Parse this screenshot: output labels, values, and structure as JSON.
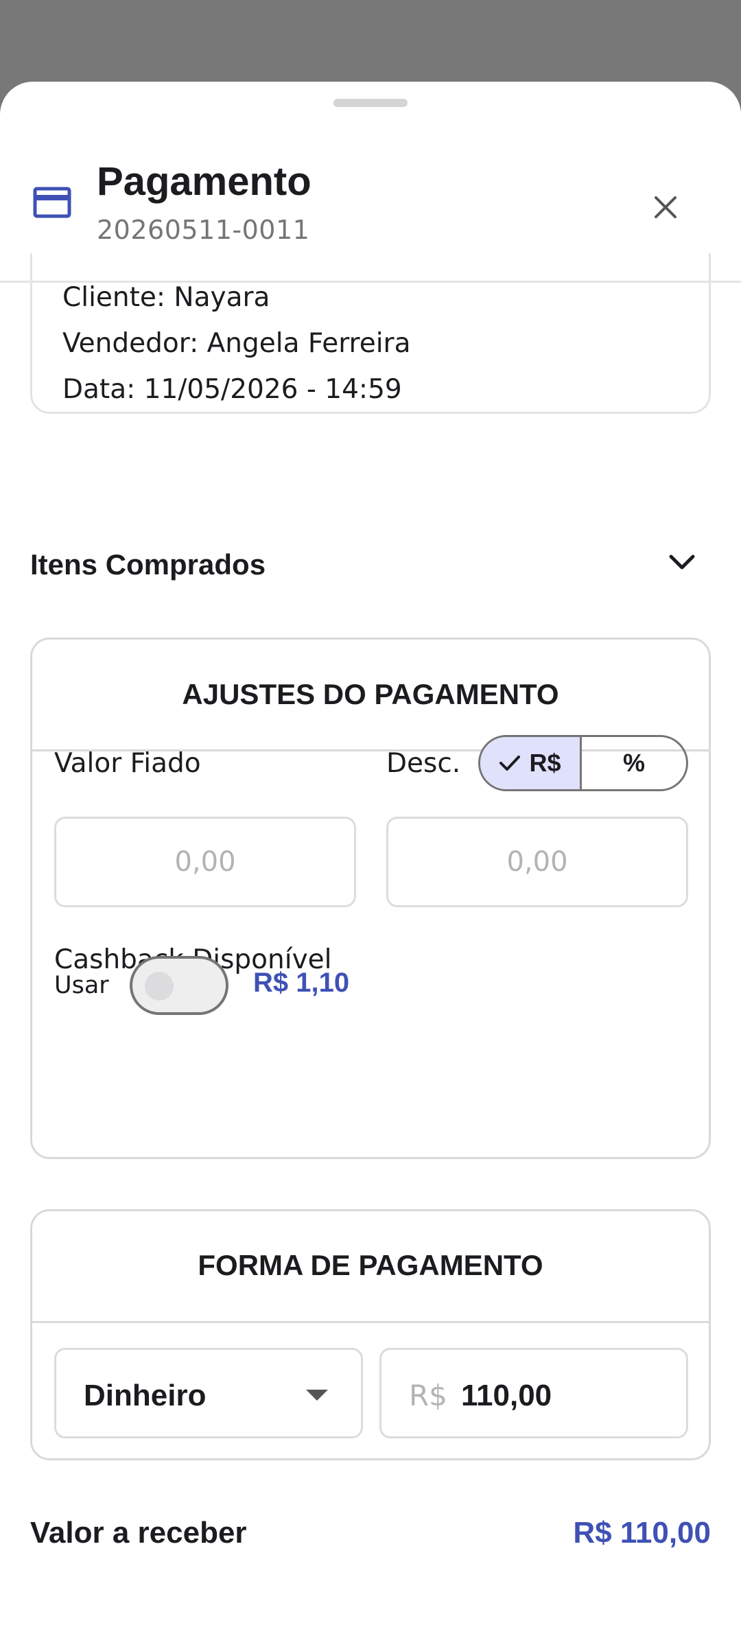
{
  "header": {
    "title": "Pagamento",
    "order_number": "20260511-0011",
    "icon": "credit-card-icon",
    "accent_color": "#3f51b5"
  },
  "order_info": {
    "client": "Cliente: Nayara",
    "seller": "Vendedor: Angela Ferreira",
    "date": "Data: 11/05/2026 - 14:59"
  },
  "items_section": {
    "label": "Itens Comprados",
    "expanded": false
  },
  "adjustments": {
    "title": "AJUSTES DO PAGAMENTO",
    "credit_label": "Valor Fiado",
    "credit_placeholder": "0,00",
    "discount_label": "Desc.",
    "discount_modes": [
      "R$",
      "%"
    ],
    "discount_selected": "R$",
    "discount_placeholder": "0,00",
    "cashback_label": "Cashback Disponível",
    "use_label": "Usar",
    "use_cashback": false,
    "cashback_value": "R$ 1,10"
  },
  "payment_method": {
    "title": "FORMA DE PAGAMENTO",
    "selected": "Dinheiro",
    "currency_prefix": "R$",
    "amount": "110,00"
  },
  "summary": {
    "label": "Valor a receber",
    "value": "R$ 110,00"
  }
}
